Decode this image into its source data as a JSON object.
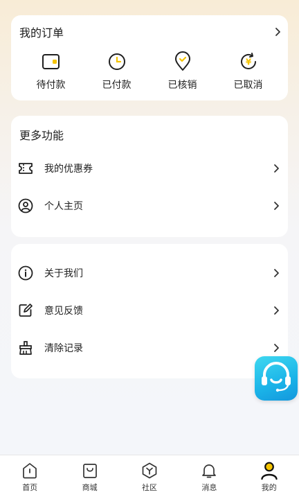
{
  "orders": {
    "title": "我的订单",
    "items": [
      {
        "label": "待付款",
        "icon": "wallet-icon"
      },
      {
        "label": "已付款",
        "icon": "clock-icon"
      },
      {
        "label": "已核销",
        "icon": "location-check-icon"
      },
      {
        "label": "已取消",
        "icon": "yen-refresh-icon"
      }
    ]
  },
  "more": {
    "title": "更多功能",
    "items": [
      {
        "label": "我的优惠券",
        "icon": "coupon-icon"
      },
      {
        "label": "个人主页",
        "icon": "user-circle-icon"
      }
    ]
  },
  "settings": {
    "items": [
      {
        "label": "关于我们",
        "icon": "info-icon"
      },
      {
        "label": "意见反馈",
        "icon": "edit-icon"
      },
      {
        "label": "清除记录",
        "icon": "broom-icon"
      }
    ]
  },
  "floating": {
    "icon": "customer-service-icon"
  },
  "tabbar": {
    "items": [
      {
        "label": "首页",
        "icon": "home-icon"
      },
      {
        "label": "商城",
        "icon": "shopping-bag-icon"
      },
      {
        "label": "社区",
        "icon": "community-icon"
      },
      {
        "label": "消息",
        "icon": "bell-icon"
      },
      {
        "label": "我的",
        "icon": "person-icon",
        "active": true
      }
    ]
  },
  "colors": {
    "accent": "#f5c400",
    "text": "#1f1f1f",
    "service": "#1ab3e8"
  }
}
